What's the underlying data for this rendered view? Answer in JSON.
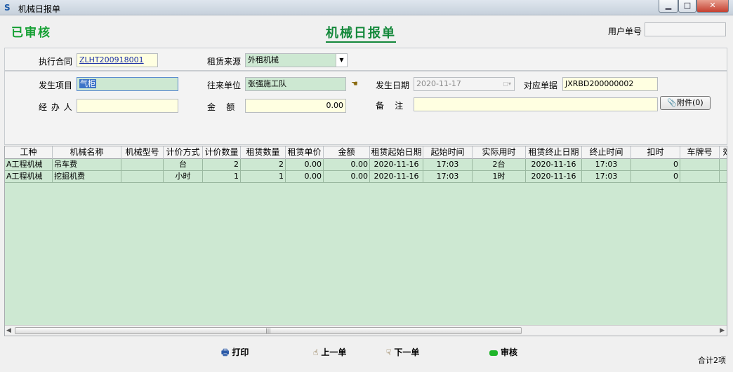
{
  "window": {
    "title": "机械日报单",
    "min": "▁",
    "max": "□",
    "close": "✕"
  },
  "status": "已审核",
  "form_title": "机械日报单",
  "user_no": {
    "label": "用户单号",
    "value": ""
  },
  "contract": {
    "label": "执行合同",
    "value": "ZLHT200918001"
  },
  "lease_source": {
    "label": "租赁来源",
    "value": "外租机械"
  },
  "project": {
    "label": "发生项目",
    "value": "气柜"
  },
  "unit": {
    "label": "往来单位",
    "value": "张强施工队"
  },
  "date": {
    "label": "发生日期",
    "value": "2020-11-17"
  },
  "doc": {
    "label": "对应单据",
    "value": "JXRBD200000002"
  },
  "handler": {
    "label": "经 办 人",
    "value": ""
  },
  "amount": {
    "label": "金    额",
    "value": "0.00"
  },
  "remark": {
    "label": "备    注",
    "value": ""
  },
  "attach_label": "附件(0)",
  "table": {
    "headers": [
      "工种",
      "机械名称",
      "机械型号",
      "计价方式",
      "计价数量",
      "租赁数量",
      "租赁单价",
      "金额",
      "租赁起始日期",
      "起始时间",
      "实际用时",
      "租赁终止日期",
      "终止时间",
      "扣时",
      "车牌号",
      "效"
    ],
    "rows": [
      [
        "A工程机械",
        "吊车费",
        "",
        "台",
        "2",
        "2",
        "0.00",
        "0.00",
        "2020-11-16",
        "17:03",
        "2台",
        "2020-11-16",
        "17:03",
        "0",
        "",
        ""
      ],
      [
        "A工程机械",
        "挖掘机费",
        "",
        "小时",
        "1",
        "1",
        "0.00",
        "0.00",
        "2020-11-16",
        "17:03",
        "1时",
        "2020-11-16",
        "17:03",
        "0",
        "",
        ""
      ]
    ]
  },
  "buttons": {
    "print": "打印",
    "prev": "上一单",
    "next": "下一单",
    "audit": "审核"
  },
  "total": "合计2项",
  "colors": {
    "status_green": "#16a034",
    "grid_bg": "#cde8d2",
    "input_yellow": "#ffffe1"
  }
}
